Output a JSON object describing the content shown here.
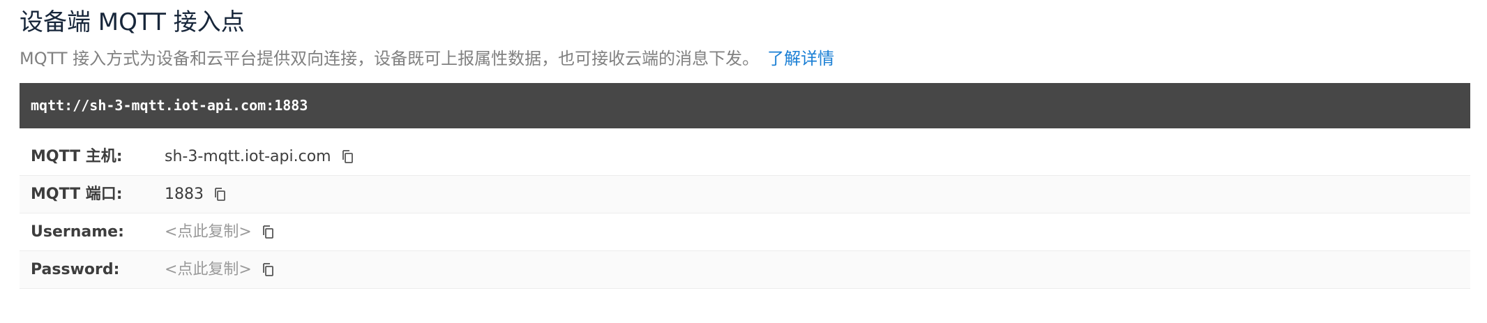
{
  "header": {
    "title": "设备端 MQTT 接入点",
    "description": "MQTT 接入方式为设备和云平台提供双向连接，设备既可上报属性数据，也可接收云端的消息下发。",
    "learn_more_label": "了解详情"
  },
  "endpoint": {
    "url": "mqtt://sh-3-mqtt.iot-api.com:1883"
  },
  "fields": [
    {
      "label": "MQTT 主机:",
      "value": "sh-3-mqtt.iot-api.com",
      "is_placeholder": false,
      "icon": "copy-icon"
    },
    {
      "label": "MQTT 端口:",
      "value": "1883",
      "is_placeholder": false,
      "icon": "copy-icon"
    },
    {
      "label": "Username:",
      "value": "<点此复制>",
      "is_placeholder": true,
      "icon": "copy-icon"
    },
    {
      "label": "Password:",
      "value": "<点此复制>",
      "is_placeholder": true,
      "icon": "copy-icon"
    }
  ],
  "colors": {
    "title": "#17263a",
    "link": "#1a7fd4",
    "endpoint_bg": "#474747",
    "placeholder": "#9a9a9a"
  }
}
